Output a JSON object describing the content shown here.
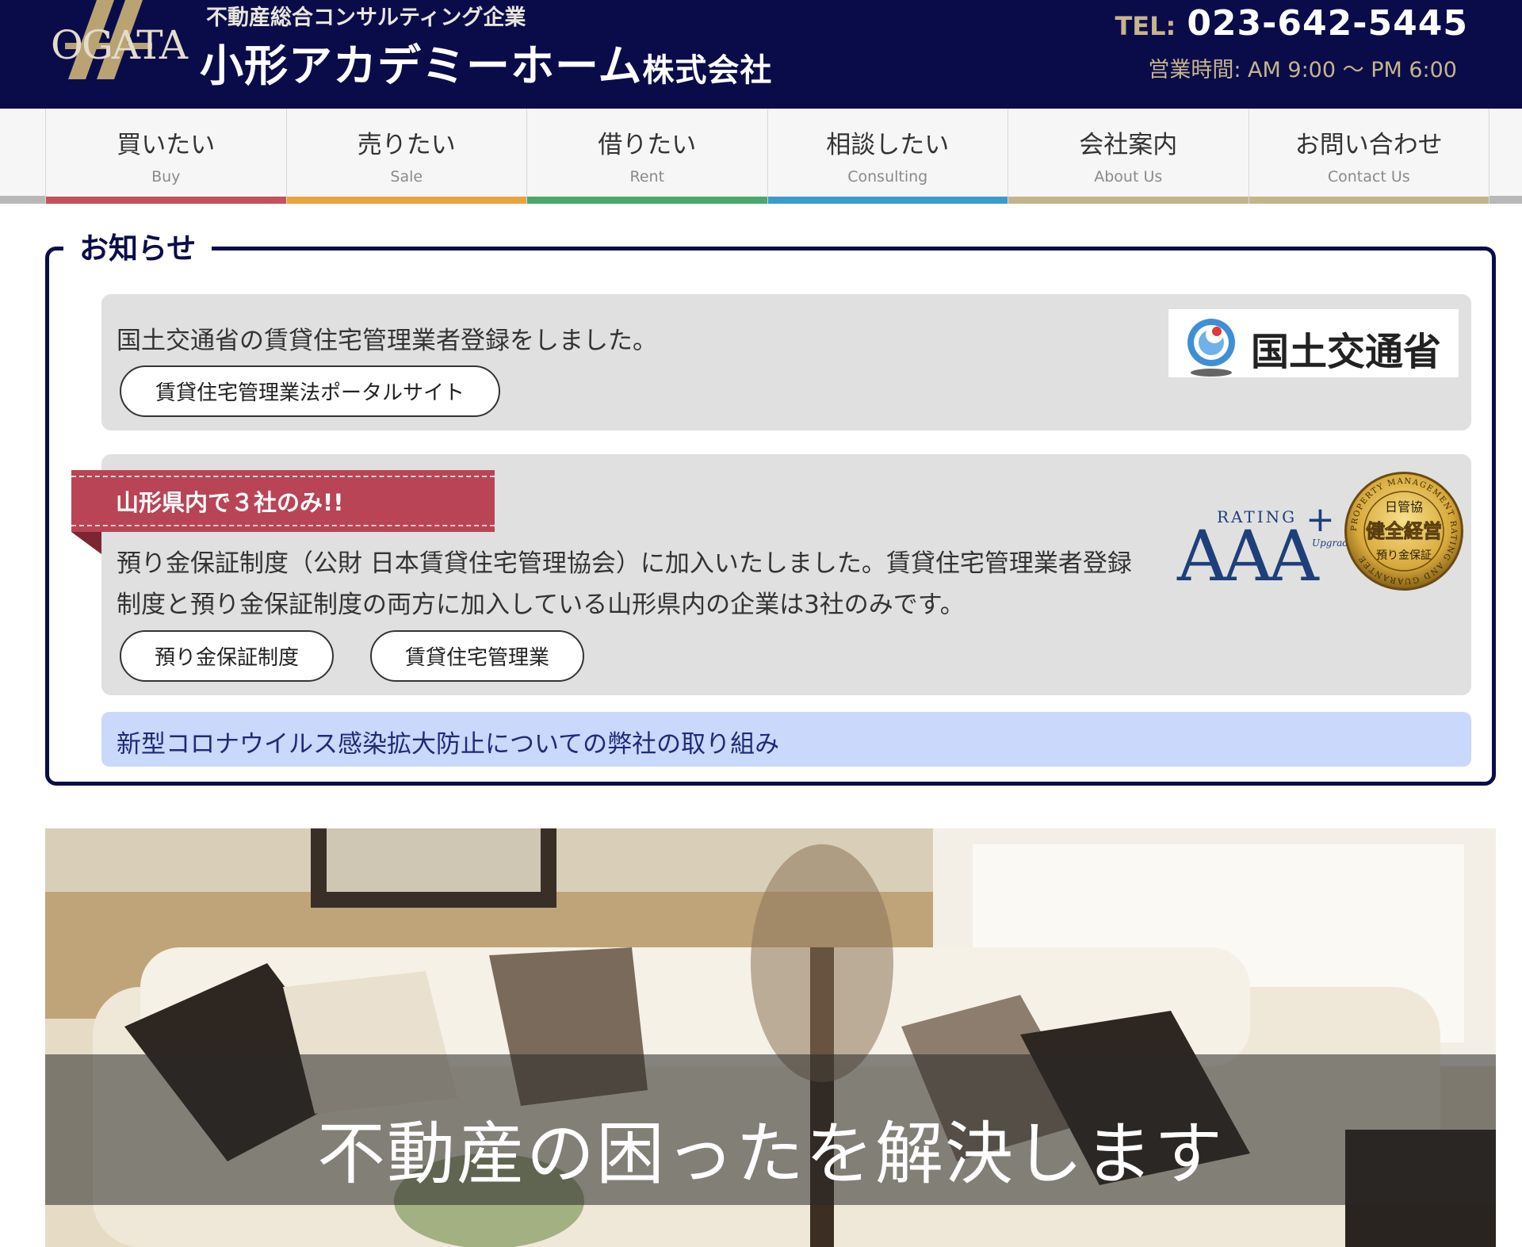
{
  "header": {
    "logo_text": "OGATA",
    "tagline": "不動産総合コンサルティング企業",
    "company_name": "小形アカデミーホーム",
    "company_suffix": "株式会社",
    "tel_label": "TEL:",
    "tel_number": "023-642-5445",
    "hours": "営業時間: AM 9:00 〜 PM 6:00",
    "colors": {
      "background": "#0a0c4a",
      "gold": "#c7b58c"
    }
  },
  "nav": {
    "items": [
      {
        "jp": "買いたい",
        "en": "Buy",
        "color": "#c6505d"
      },
      {
        "jp": "売りたい",
        "en": "Sale",
        "color": "#e9a33b"
      },
      {
        "jp": "借りたい",
        "en": "Rent",
        "color": "#49a96a"
      },
      {
        "jp": "相談したい",
        "en": "Consulting",
        "color": "#3a9bd0"
      },
      {
        "jp": "会社案内",
        "en": "About Us",
        "color": "#c5b48a"
      },
      {
        "jp": "お問い合わせ",
        "en": "Contact Us",
        "color": "#c5b48a"
      }
    ]
  },
  "notice": {
    "title": "お知らせ",
    "item1": {
      "text": "国土交通省の賃貸住宅管理業者登録をしました。",
      "button": "賃貸住宅管理業法ポータルサイト",
      "logo_text": "国土交通省"
    },
    "item2": {
      "ribbon": "山形県内で３社のみ!!",
      "text": "預り金保証制度（公財 日本賃貸住宅管理協会）に加入いたしました。賃貸住宅管理業者登録制度と預り金保証制度の両方に加入している山形県内の企業は3社のみです。",
      "button1": "預り金保証制度",
      "button2": "賃貸住宅管理業",
      "rating_label": "RATING",
      "rating_value": "AAA",
      "rating_plus": "+",
      "rating_upgrade": "Upgrade",
      "seal_top": "日管協",
      "seal_main": "健全経営",
      "seal_bottom": "預り金保証",
      "seal_ring": "PROPERTY MANAGEMENT RATING AND GUARANTEE"
    },
    "item3": {
      "text": "新型コロナウイルス感染拡大防止についての弊社の取り組み"
    }
  },
  "hero": {
    "caption": "不動産の困ったを解決します"
  }
}
